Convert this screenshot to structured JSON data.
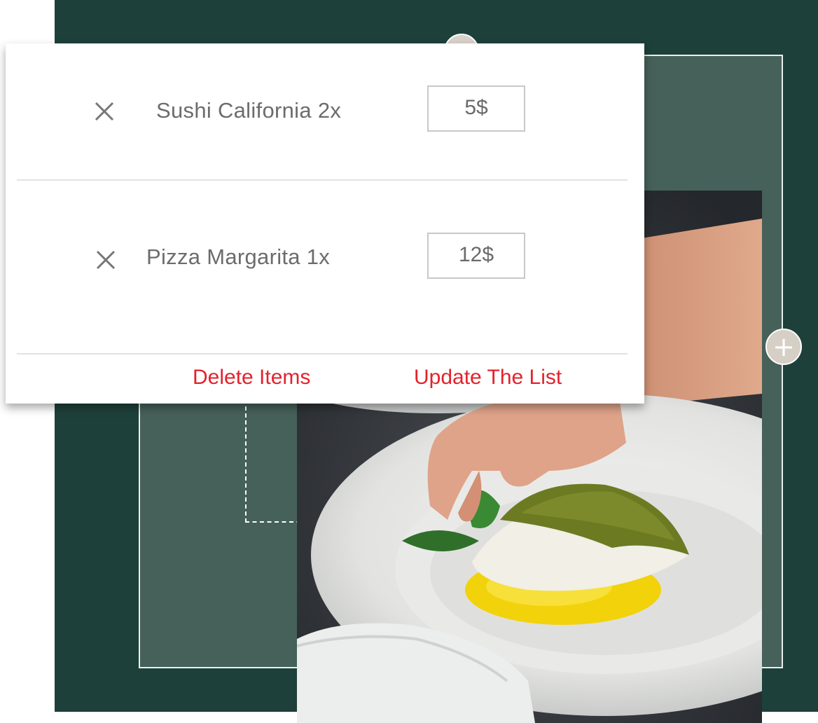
{
  "cart": {
    "items": [
      {
        "name": "Sushi California 2x",
        "price": "5$"
      },
      {
        "name": "Pizza Margarita 1x",
        "price": "12$"
      }
    ],
    "actions": {
      "delete_label": "Delete Items",
      "update_label": "Update The List"
    }
  },
  "icons": {
    "remove": "close-icon",
    "add": "plus-icon"
  },
  "colors": {
    "background_dark": "#1e403a",
    "frame_fill": "#466159",
    "action_red": "#e3222c",
    "handle": "#d6cfc5"
  }
}
